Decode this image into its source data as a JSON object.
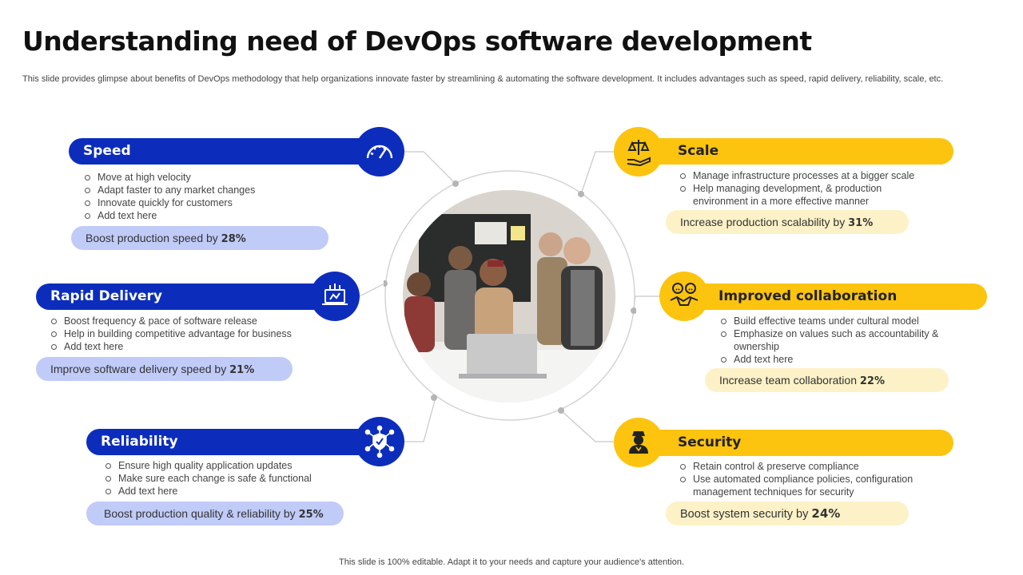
{
  "title": "Understanding need of DevOps software development",
  "subtitle": "This slide provides glimpse about benefits of DevOps methodology that help organizations innovate faster by streamlining & automating the software development. It includes advantages such as speed, rapid delivery, reliability, scale, etc.",
  "footer": "This slide is 100% editable. Adapt it to your needs and capture your audience's attention.",
  "colors": {
    "blue": "#0c2dbc",
    "yellow": "#fcc40e",
    "blue_light": "#c0cbf8",
    "yellow_light": "#fdf1c7"
  },
  "center_image": "team-working-on-laptop-photo",
  "cards": {
    "speed": {
      "heading": "Speed",
      "icon": "speedometer-icon",
      "bullets": [
        "Move at high velocity",
        "Adapt faster to any market changes",
        "Innovate  quickly for customers",
        "Add text here"
      ],
      "metric_text": "Boost production speed by ",
      "metric_value": "28%"
    },
    "rapid_delivery": {
      "heading": "Rapid Delivery",
      "icon": "laptop-deployment-icon",
      "bullets": [
        "Boost frequency  & pace of software release",
        "Help in building competitive advantage for business",
        "Add text here"
      ],
      "metric_text": "Improve software delivery speed by ",
      "metric_value": "21%"
    },
    "reliability": {
      "heading": "Reliability",
      "icon": "shield-network-icon",
      "bullets": [
        "Ensure high quality application updates",
        "Make sure each change is safe & functional",
        "Add text here"
      ],
      "metric_text": "Boost production quality & reliability  by ",
      "metric_value": "25%"
    },
    "scale": {
      "heading": "Scale",
      "icon": "balance-scale-hand-icon",
      "bullets": [
        "Manage infrastructure  processes at a bigger scale",
        "Help managing development,  & production environment  in a more effective  manner"
      ],
      "metric_text": "Increase production scalability by ",
      "metric_value": "31%"
    },
    "collaboration": {
      "heading": "Improved collaboration",
      "icon": "handshake-team-icon",
      "bullets": [
        "Build effective  teams under cultural model",
        "Emphasize on values  such as accountability & ownership",
        "Add text here"
      ],
      "metric_text": "Increase team collaboration ",
      "metric_value": "22%"
    },
    "security": {
      "heading": "Security",
      "icon": "security-person-icon",
      "bullets": [
        "Retain control & preserve  compliance",
        "Use automated compliance policies, configuration management  techniques for security"
      ],
      "metric_text": "Boost system security by ",
      "metric_value": "24%"
    }
  }
}
